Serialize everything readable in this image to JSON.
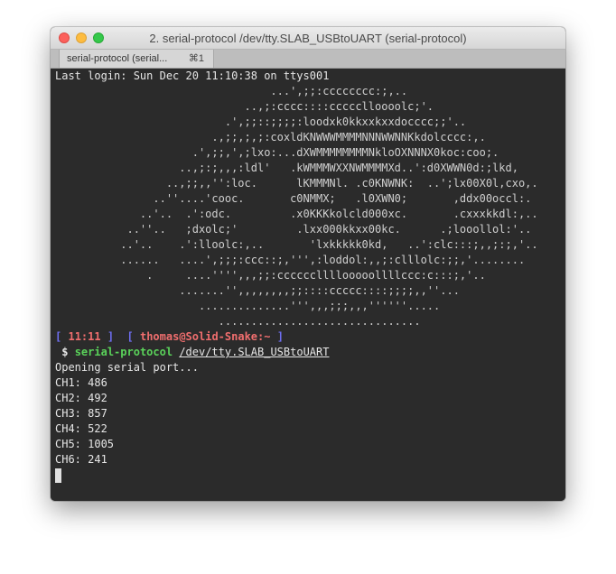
{
  "window": {
    "title": "2. serial-protocol /dev/tty.SLAB_USBtoUART (serial-protocol)",
    "tab_label": "serial-protocol (serial...",
    "tab_shortcut": "⌘1"
  },
  "terminal": {
    "last_login": "Last login: Sun Dec 20 11:10:38 on ttys001",
    "ascii_art": [
      "                                 ...',;;:cccccccc:;,..",
      "                             ..,;:cccc::::ccccclloooolc;'.",
      "                          .',;;::;;;;:loodxk0kkxxkxxdocccc;;'..",
      "                        .,;;,;,;:coxldKNWWWMMMMNNNWWNNKkdolcccc:,.",
      "                     .',;;,',;lxo:...dXWMMMMMMMMNkloOXNNNX0koc:coo;.",
      "                   ..,;:;,,,:ldl'   .kWMMMWXXNWMMMMXd..':d0XWWN0d:;lkd,",
      "                 ..,;;,,'':loc.      lKMMMNl. .c0KNWNK:  ..';lx00X0l,cxo,.",
      "               ..''....'cooc.       c0NMMX;   .l0XWN0;       ,ddx00occl:.",
      "             ..'..  .':odc.         .x0KKKkolcld000xc.       .cxxxkkdl:,..",
      "           ..''..   ;dxolc;'         .lxx000kkxx00kc.      .;looollol:'..",
      "          ..'..    .':lloolc:,..       'lxkkkkk0kd,   ..':clc:::;,,;:;,'..",
      "          ......   ....',;;;:ccc::;,''',:loddol:,,;:clllolc:;;,'........",
      "              .     ....'''',,,;;:ccccccllllooooollllccc:c:::;,'..",
      "                   .......'',,,,,,,,;;::::ccccc::::;;;;,,''...",
      "                      ..............''',,,;;;,,,''''''.....",
      "                         ..............................."
    ],
    "prompt": {
      "bracket_open": "[",
      "time": "11:11",
      "bracket_close": "]",
      "user_bracket_open": "[",
      "user_host": "thomas@Solid-Snake:~",
      "user_bracket_close": "]",
      "symbol": "$",
      "command": "serial-protocol",
      "argument": "/dev/tty.SLAB_USBtoUART"
    },
    "output": [
      "Opening serial port...",
      "CH1: 486",
      "CH2: 492",
      "CH3: 857",
      "CH4: 522",
      "CH5: 1005",
      "CH6: 241"
    ]
  },
  "colors": {
    "terminal_bg": "#2b2b2b",
    "prompt_bracket": "#6e6ef0",
    "prompt_user": "#f06e6e",
    "command": "#5ad25a"
  }
}
